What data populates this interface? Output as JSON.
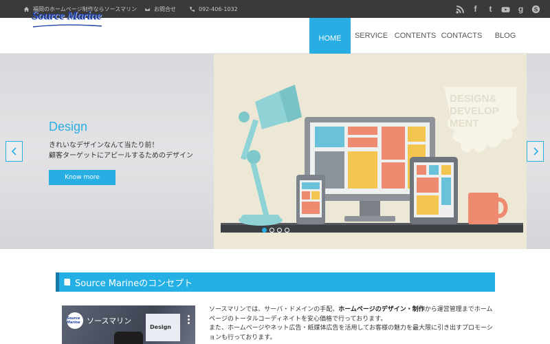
{
  "topbar": {
    "tagline": "福岡のホームページ制作ならソースマリン",
    "contact": "お問合せ",
    "phone": "092-406-1032",
    "social": [
      "rss-icon",
      "facebook-icon",
      "twitter-icon",
      "youtube-icon",
      "google-plus-icon",
      "skype-icon"
    ]
  },
  "header": {
    "logo": "Source Marine",
    "nav": [
      "HOME",
      "SERVICE",
      "CONTENTS",
      "CONTACTS",
      "BLOG"
    ],
    "active_nav": "HOME"
  },
  "slider": {
    "title": "Design",
    "line1": "きれいなデザインなんて当たり前！",
    "line2": "顧客ターゲットにアピールするためのデザイン",
    "button": "Know more",
    "art_text": [
      "DESIGN&",
      "DEVELOP",
      "MENT"
    ],
    "dots": 4,
    "active_dot": 0
  },
  "concept": {
    "heading": "Source Marineのコンセプト",
    "video_logo": "Source Marine",
    "video_title": "ソースマリン",
    "video_card": "Design",
    "text_before": "ソースマリンでは、サーバ・ドメインの手配、",
    "text_bold": "ホームページのデザイン・制作",
    "text_after": "から運営管理までホームページのトータルコーディネイトを安心価格で行っております。",
    "text_line2": "また、ホームページやネット広告・紙媒体広告を活用してお客様の魅力を最大限に引き出すプロモーションも行っております。"
  },
  "colors": {
    "accent": "#29aee3",
    "topbar": "#3a3a3a",
    "art_bg": "#ede8d6"
  }
}
